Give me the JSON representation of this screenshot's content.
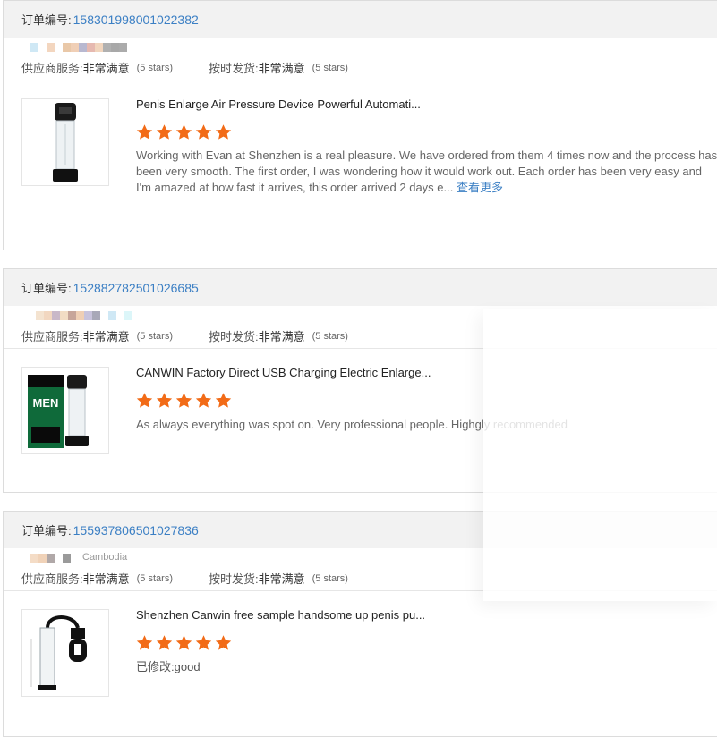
{
  "colors": {
    "link": "#3b7fc4",
    "star": "#f26b17",
    "header_bg": "#f2f2f2",
    "border": "#dcdcdc"
  },
  "orders": [
    {
      "order_label": "订单编号:",
      "order_number": "158301998001022382",
      "buyer_country": "",
      "supplier_service_label": "供应商服务:",
      "supplier_service_value": "非常满意",
      "supplier_service_stars": "(5 stars)",
      "on_time_label": "按时发货:",
      "on_time_value": "非常满意",
      "on_time_stars": "(5 stars)",
      "product_title": "Penis Enlarge Air Pressure Device Powerful Automati...",
      "rating": 5,
      "review_text": "Working with Evan at Shenzhen is a real pleasure. We have ordered from them 4 times now and the process has been very smooth.  The first order, I was wondering how it would work out.  Each order has been very easy and I'm amazed at how fast it arrives, this order arrived 2 days e...",
      "review_prefix": "",
      "more_label": "查看更多",
      "thumb_icon": "black-pump-icon"
    },
    {
      "order_label": "订单编号:",
      "order_number": "152882782501026685",
      "buyer_country": "",
      "supplier_service_label": "供应商服务:",
      "supplier_service_value": "非常满意",
      "supplier_service_stars": "(5 stars)",
      "on_time_label": "按时发货:",
      "on_time_value": "非常满意",
      "on_time_stars": "(5 stars)",
      "product_title": "CANWIN Factory Direct USB Charging Electric Enlarge...",
      "rating": 5,
      "review_text": "As always everything was spot on. Very professional people. Highgly recommended",
      "review_prefix": "",
      "more_label": "",
      "thumb_icon": "boxed-pump-icon",
      "box_text": "MEN"
    },
    {
      "order_label": "订单编号:",
      "order_number": "155937806501027836",
      "buyer_country": "Cambodia",
      "supplier_service_label": "供应商服务:",
      "supplier_service_value": "非常满意",
      "supplier_service_stars": "(5 stars)",
      "on_time_label": "按时发货:",
      "on_time_value": "非常满意",
      "on_time_stars": "(5 stars)",
      "product_title": "Shenzhen Canwin free sample handsome up penis pu...",
      "rating": 5,
      "review_text": "good",
      "review_prefix": "已修改:",
      "more_label": "",
      "thumb_icon": "manual-pump-icon"
    }
  ]
}
